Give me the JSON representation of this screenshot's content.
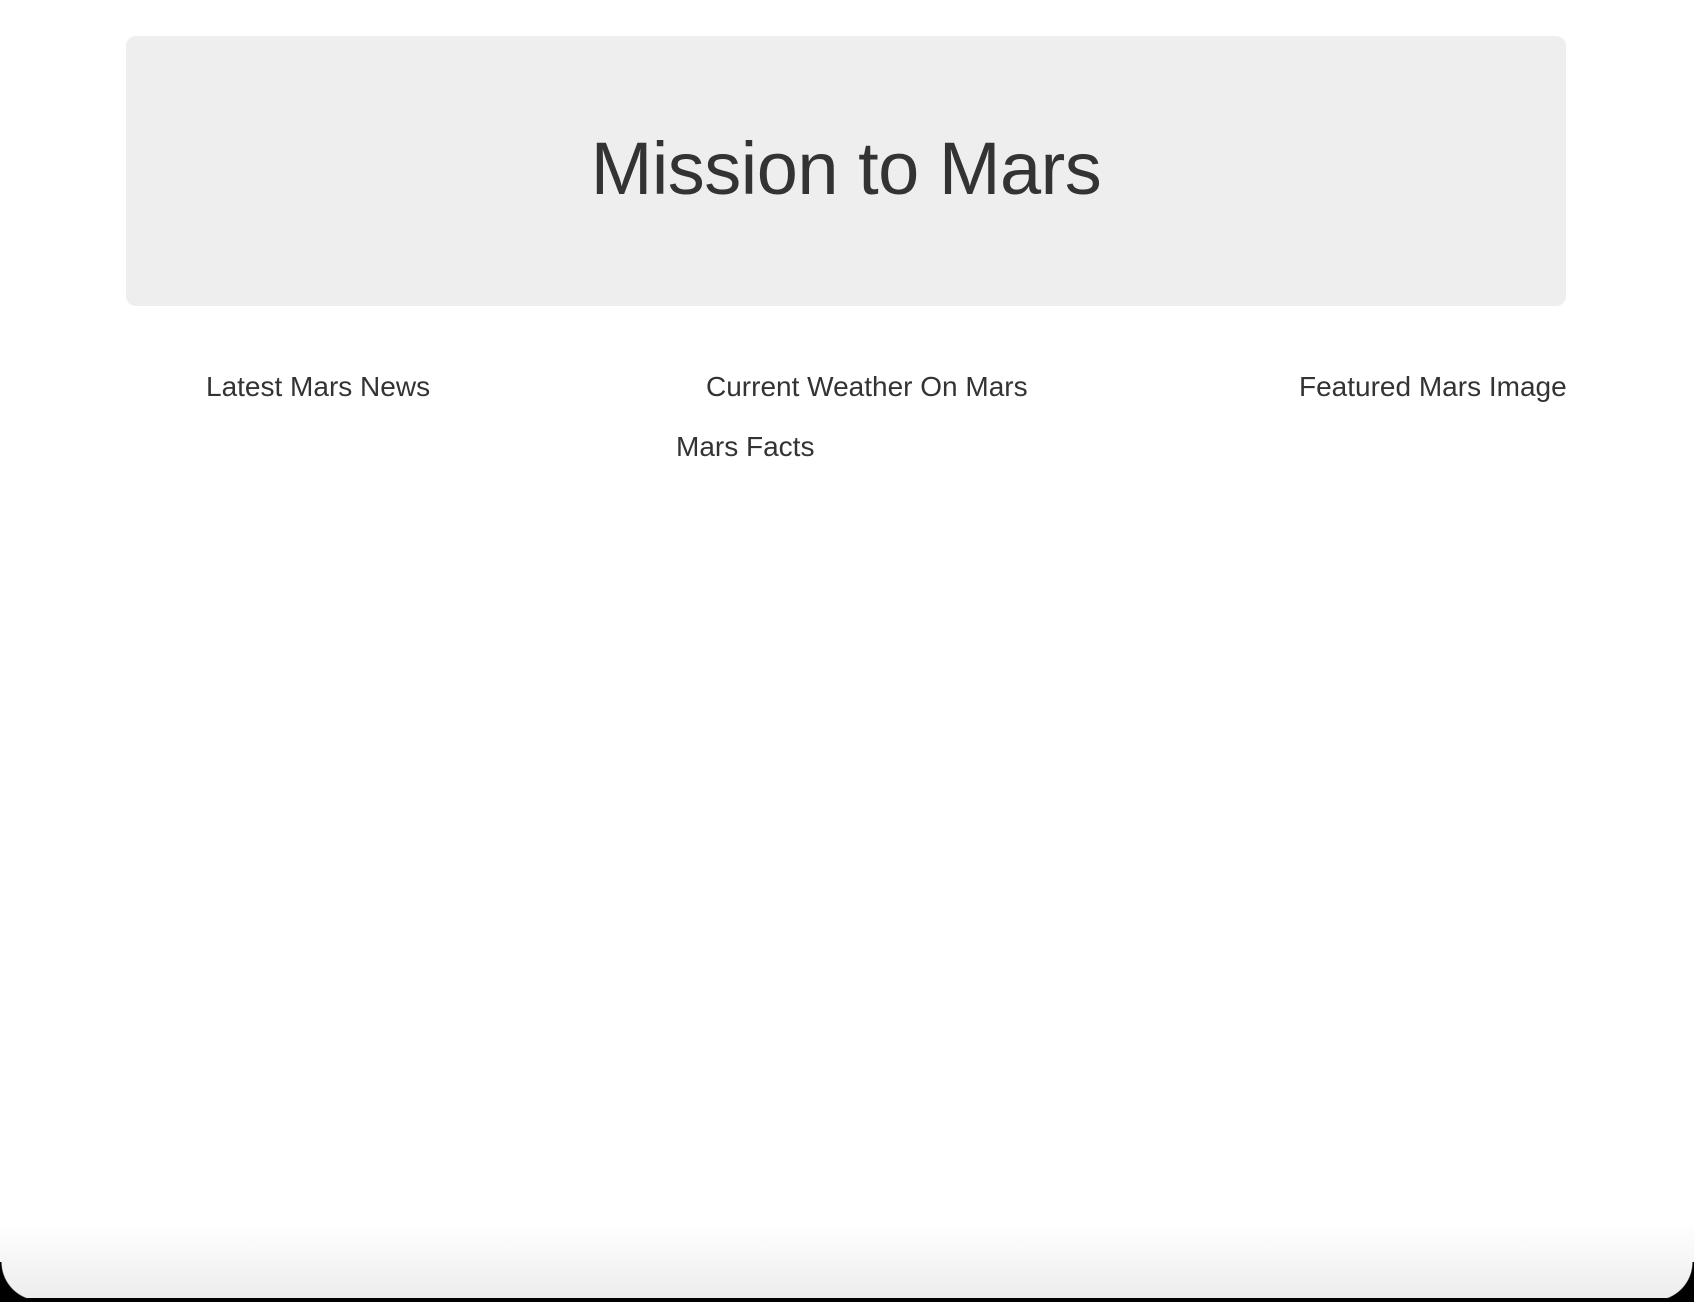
{
  "page": {
    "title": "Mission to Mars"
  },
  "sections": {
    "news_heading": "Latest Mars News",
    "weather_heading": "Current Weather On Mars",
    "image_heading": "Featured Mars Image",
    "facts_heading": "Mars Facts"
  },
  "colors": {
    "text": "#333333",
    "jumbotron_bg": "#eeeeee",
    "page_bg": "#ffffff"
  }
}
